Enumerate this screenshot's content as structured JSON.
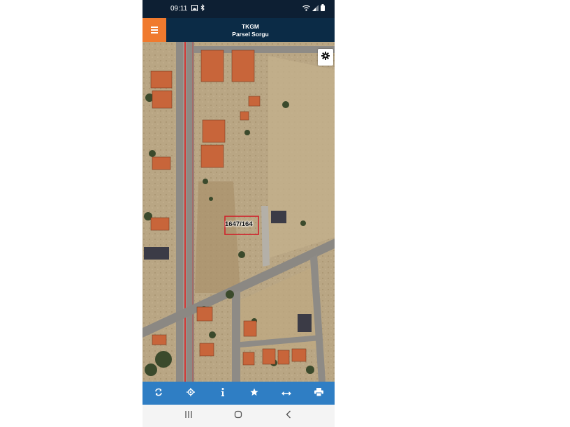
{
  "status_bar": {
    "time": "09:11",
    "left_icons": [
      "gallery-icon",
      "bluetooth-icon"
    ],
    "right_icons": [
      "wifi-icon",
      "signal-icon",
      "battery-icon"
    ]
  },
  "app_bar": {
    "title": "TKGM",
    "subtitle": "Parsel Sorgu",
    "menu_icon": "menu-icon",
    "accent_color": "#f07a2e",
    "background_color": "#0b2b46"
  },
  "map": {
    "parcel_label": "1647/164",
    "settings_icon": "gear-icon",
    "parcel_outline_color": "#d0202a",
    "road_line_color": "#e02020"
  },
  "toolbar": {
    "background_color": "#2f7ec4",
    "tools": [
      "refresh-icon",
      "locate-icon",
      "info-icon",
      "star-icon",
      "measure-icon",
      "print-icon"
    ]
  },
  "nav_bar": {
    "buttons": [
      "recents-button",
      "home-button",
      "back-button"
    ]
  }
}
